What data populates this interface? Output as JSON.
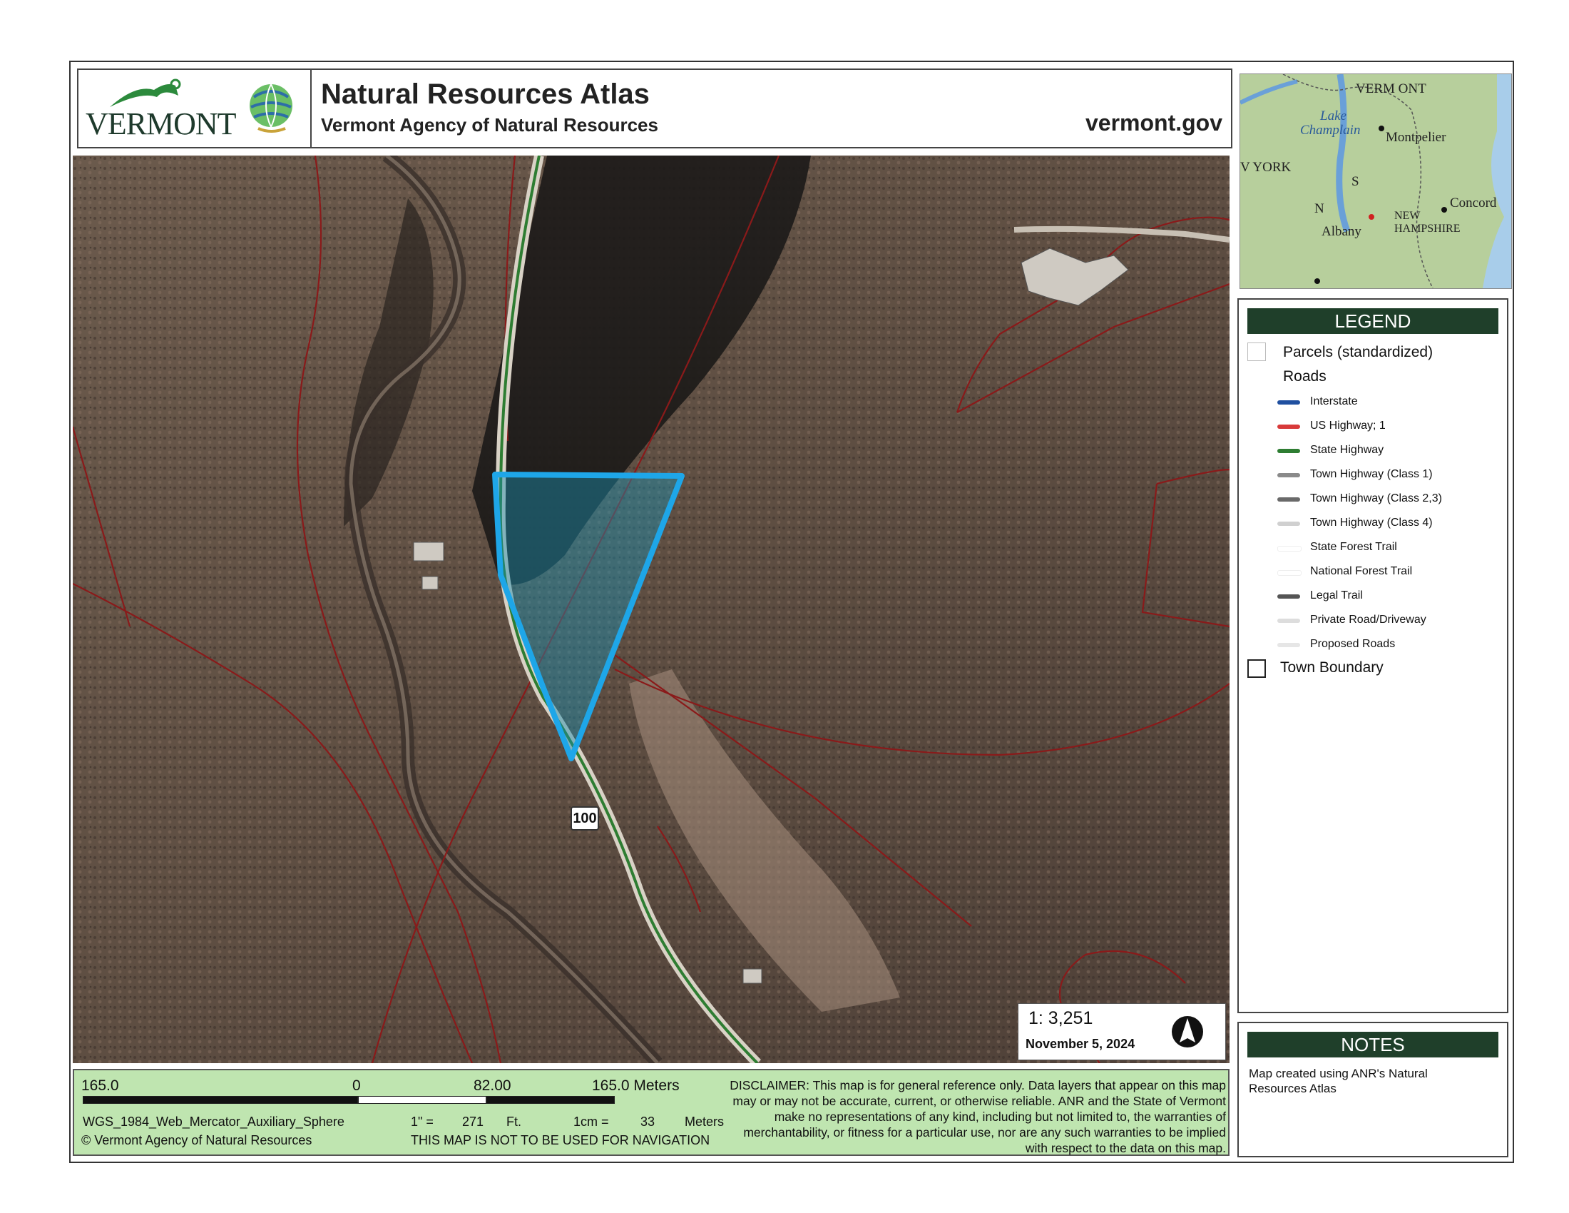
{
  "header": {
    "logo_text": "VERMONT",
    "title": "Natural Resources Atlas",
    "subtitle": "Vermont Agency of Natural Resources",
    "site": "vermont.gov"
  },
  "map": {
    "route_shield": "100",
    "scale_ratio": "1:  3,251",
    "date": "November 5, 2024",
    "north_arrow": "north-arrow-icon",
    "parcel_highlight_color": "#1ea6e8",
    "parcel_line_color": "#8a1a1a",
    "state_highway_color": "#2e7d32"
  },
  "inset": {
    "labels": {
      "vermont": "VERM ONT",
      "lake": "Lake",
      "champlain": "Champlain",
      "montpelier": "Montpelier",
      "york": "V YORK",
      "concord": "Concord",
      "new": "NEW",
      "hampshire": "HAMPSHIRE",
      "albany": "Albany",
      "n": "N",
      "s": "S"
    }
  },
  "legend": {
    "title": "LEGEND",
    "parcels": "Parcels (standardized)",
    "roads": "Roads",
    "road_items": [
      {
        "label": "Interstate",
        "color": "#2050a0"
      },
      {
        "label": "US Highway; 1",
        "color": "#d83a3a"
      },
      {
        "label": "State Highway",
        "color": "#2e7d32"
      },
      {
        "label": "Town Highway (Class 1)",
        "color": "#8a8a8a"
      },
      {
        "label": "Town Highway (Class 2,3)",
        "color": "#6a6a6a"
      },
      {
        "label": "Town Highway (Class 4)",
        "color": "#d0d0d0"
      },
      {
        "label": "State Forest Trail",
        "color": "#ffffff"
      },
      {
        "label": "National Forest Trail",
        "color": "#ffffff"
      },
      {
        "label": "Legal Trail",
        "color": "#555555"
      },
      {
        "label": "Private Road/Driveway",
        "color": "#dddddd"
      },
      {
        "label": "Proposed Roads",
        "color": "#e6e6e6"
      }
    ],
    "town_boundary": "Town Boundary"
  },
  "notes": {
    "title": "NOTES",
    "text": "Map created using ANR's Natural Resources Atlas"
  },
  "footer": {
    "scale_left": "165.0",
    "scale_zero": "0",
    "scale_mid": "82.00",
    "scale_right": "165.0 Meters",
    "projection": "WGS_1984_Web_Mercator_Auxiliary_Sphere",
    "copyright": "© Vermont Agency of Natural Resources",
    "inch_label": "1\" =",
    "inch_value": "271",
    "inch_unit": "Ft.",
    "cm_label": "1cm =",
    "cm_value": "33",
    "cm_unit": "Meters",
    "nav_warning": "THIS MAP IS NOT TO BE USED FOR NAVIGATION",
    "disclaimer": "DISCLAIMER: This map is for general reference only. Data layers that appear on this map may or may not be accurate, current, or otherwise reliable. ANR and the State of Vermont make no representations of any kind, including but not limited to, the warranties of merchantability, or fitness for a particular use, nor are any such warranties to be implied with respect to the data on this map."
  }
}
